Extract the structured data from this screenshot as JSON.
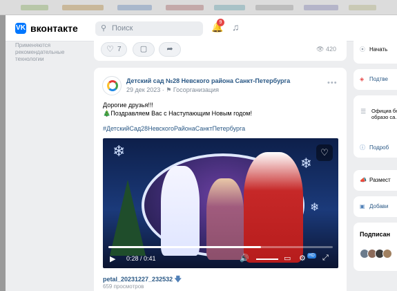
{
  "header": {
    "logo_badge": "VK",
    "logo_text": "вконтакте",
    "search_placeholder": "Поиск",
    "notification_count": "9"
  },
  "left_sidebar": {
    "note": "Применяются рекомендательные технологии"
  },
  "prev_post": {
    "likes": "7",
    "views": "420"
  },
  "post": {
    "author": "Детский сад №28 Невского района Санкт-Петербурга",
    "date": "29 дек 2023",
    "org_type": "Госорганизация",
    "text_line1": "Дорогие друзья!!!",
    "text_line2": "Поздравляем Вас с Наступающим Новым годом!",
    "hashtag": "#ДетскийСад28НевскогоРайонаСанктПетербурга",
    "video": {
      "time": "0:28 / 0:41",
      "progress": 0.68,
      "quality_badge": "HD",
      "filename": "petal_20231227_232532",
      "views_text": "659 просмотров"
    }
  },
  "right_sidebar": {
    "start_label": "Начать",
    "confirm_label": "Подтве",
    "official_text": "Официа бюдже образо са...",
    "official_more": "Ещ",
    "details_label": "Подроб",
    "place_label": "Размест",
    "add_label": "Добави",
    "subscribers_label": "Подписан"
  },
  "colors": {
    "accent": "#0077ff",
    "link": "#2a5885",
    "badge": "#e64646"
  }
}
